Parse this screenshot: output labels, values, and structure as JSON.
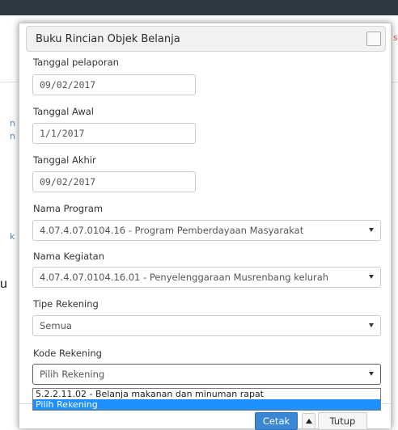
{
  "modal": {
    "title": "Buku Rincian Objek Belanja"
  },
  "form": {
    "tanggal_pelaporan": {
      "label": "Tanggal pelaporan",
      "value": "09/02/2017"
    },
    "tanggal_awal": {
      "label": "Tanggal Awal",
      "value": "1/1/2017"
    },
    "tanggal_akhir": {
      "label": "Tanggal Akhir",
      "value": "09/02/2017"
    },
    "nama_program": {
      "label": "Nama Program",
      "value": "4.07.4.07.0104.16 - Program Pemberdayaan Masyarakat"
    },
    "nama_kegiatan": {
      "label": "Nama Kegiatan",
      "value": "4.07.4.07.0104.16.01 - Penyelenggaraan Musrenbang kelurah"
    },
    "tipe_rekening": {
      "label": "Tipe Rekening",
      "value": "Semua"
    },
    "kode_rekening": {
      "label": "Kode Rekening",
      "value": "Pilih Rekening",
      "options": [
        "5.2.2.11.02 - Belanja makanan dan minuman rapat",
        "Pilih Rekening"
      ],
      "highlighted_option": "Pilih Rekening"
    }
  },
  "footer": {
    "cetak_label": "Cetak",
    "tutup_label": "Tutup"
  },
  "background": {
    "fragments": [
      "n",
      "n",
      "k",
      "u",
      "s"
    ]
  },
  "colors": {
    "primary_button": "#3a87d6",
    "dropdown_highlight": "#1e90ff",
    "topbar": "#2f3943"
  }
}
